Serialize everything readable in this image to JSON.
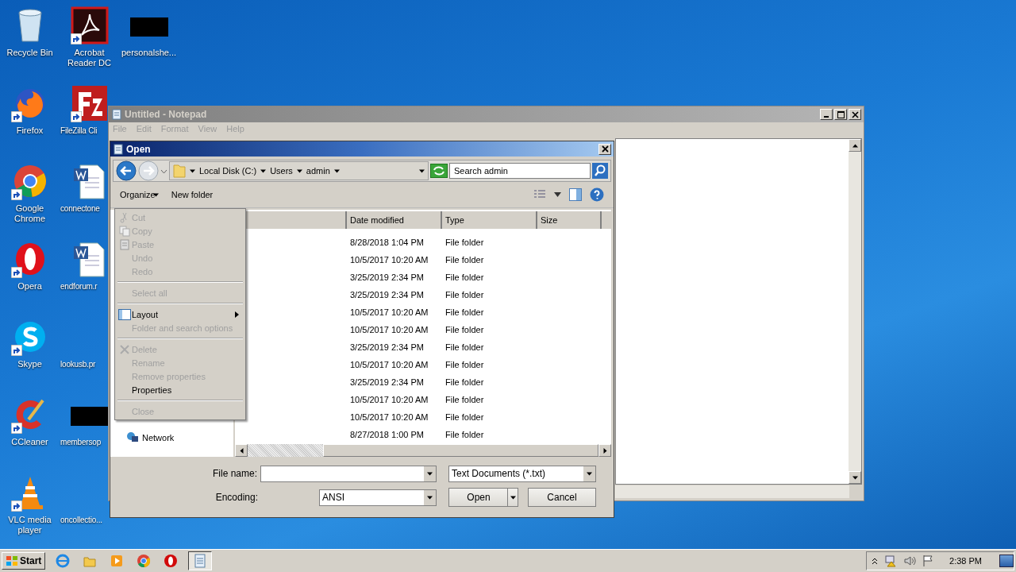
{
  "desktop": {
    "columns": [
      [
        {
          "label": "Recycle Bin",
          "shortcut": false
        },
        {
          "label": "Firefox",
          "shortcut": true
        },
        {
          "label": "Google Chrome",
          "shortcut": true
        },
        {
          "label": "Opera",
          "shortcut": true
        },
        {
          "label": "Skype",
          "shortcut": true
        },
        {
          "label": "CCleaner",
          "shortcut": true
        },
        {
          "label": "VLC media player",
          "shortcut": true
        }
      ],
      [
        {
          "label": "Acrobat Reader DC",
          "shortcut": true
        },
        {
          "label": "FileZilla Cli",
          "shortcut": true
        },
        {
          "label": "connectone",
          "shortcut": false
        },
        {
          "label": "endforum.r",
          "shortcut": false
        },
        {
          "label": "lookusb.pr",
          "shortcut": false
        },
        {
          "label": "membersop",
          "shortcut": false
        },
        {
          "label": "oncollectio...",
          "shortcut": false
        }
      ],
      [
        {
          "label": "personalshe...",
          "shortcut": false
        }
      ]
    ]
  },
  "notepad": {
    "title": "Untitled - Notepad",
    "active": false,
    "menu": [
      "File",
      "Edit",
      "Format",
      "View",
      "Help"
    ]
  },
  "open_dialog": {
    "title": "Open",
    "breadcrumb": [
      "Local Disk (C:)",
      "Users",
      "admin"
    ],
    "search": {
      "placeholder": "Search admin"
    },
    "toolbar": {
      "organize": "Organize",
      "new_folder": "New folder"
    },
    "nav": [
      "Network"
    ],
    "columns": [
      "Date modified",
      "Type",
      "Size"
    ],
    "rows": [
      {
        "date": "8/28/2018 1:04 PM",
        "type": "File folder"
      },
      {
        "date": "10/5/2017 10:20 AM",
        "type": "File folder"
      },
      {
        "date": "3/25/2019 2:34 PM",
        "type": "File folder"
      },
      {
        "date": "3/25/2019 2:34 PM",
        "type": "File folder"
      },
      {
        "date": "10/5/2017 10:20 AM",
        "type": "File folder"
      },
      {
        "date": "10/5/2017 10:20 AM",
        "type": "File folder"
      },
      {
        "date": "3/25/2019 2:34 PM",
        "type": "File folder"
      },
      {
        "date": "10/5/2017 10:20 AM",
        "type": "File folder"
      },
      {
        "date": "3/25/2019 2:34 PM",
        "type": "File folder"
      },
      {
        "date": "10/5/2017 10:20 AM",
        "type": "File folder"
      },
      {
        "date": "10/5/2017 10:20 AM",
        "type": "File folder"
      },
      {
        "date": "8/27/2018 1:00 PM",
        "type": "File folder"
      }
    ],
    "file_name": {
      "label": "File name:"
    },
    "file_type": {
      "value": "Text Documents (*.txt)"
    },
    "encoding": {
      "label": "Encoding:",
      "value": "ANSI"
    },
    "buttons": {
      "open": "Open",
      "cancel": "Cancel"
    }
  },
  "context_menu": [
    {
      "kind": "item",
      "label": "Cut",
      "disabled": true,
      "submenu": false
    },
    {
      "kind": "item",
      "label": "Copy",
      "disabled": true,
      "submenu": false
    },
    {
      "kind": "item",
      "label": "Paste",
      "disabled": true,
      "submenu": false
    },
    {
      "kind": "item",
      "label": "Undo",
      "disabled": true,
      "submenu": false
    },
    {
      "kind": "item",
      "label": "Redo",
      "disabled": true,
      "submenu": false
    },
    {
      "kind": "separator"
    },
    {
      "kind": "item",
      "label": "Select all",
      "disabled": true,
      "submenu": false
    },
    {
      "kind": "separator"
    },
    {
      "kind": "item",
      "label": "Layout",
      "disabled": false,
      "submenu": true
    },
    {
      "kind": "item",
      "label": "Folder and search options",
      "disabled": true,
      "submenu": false
    },
    {
      "kind": "separator"
    },
    {
      "kind": "item",
      "label": "Delete",
      "disabled": true,
      "submenu": false
    },
    {
      "kind": "item",
      "label": "Rename",
      "disabled": true,
      "submenu": false
    },
    {
      "kind": "item",
      "label": "Remove properties",
      "disabled": true,
      "submenu": false
    },
    {
      "kind": "item",
      "label": "Properties",
      "disabled": false,
      "submenu": false
    },
    {
      "kind": "separator"
    },
    {
      "kind": "item",
      "label": "Close",
      "disabled": true,
      "submenu": false
    }
  ],
  "taskbar": {
    "start": "Start",
    "buttons": [
      {
        "selected": false
      },
      {
        "selected": false
      },
      {
        "selected": false
      },
      {
        "selected": false
      },
      {
        "selected": false
      },
      {
        "selected": true
      }
    ],
    "clock": "2:38 PM"
  }
}
